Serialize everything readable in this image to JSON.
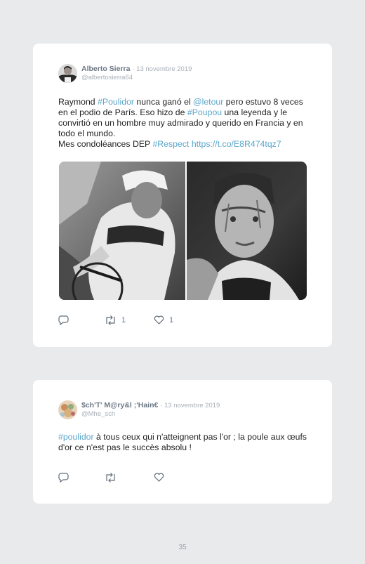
{
  "tweets": [
    {
      "name": "Alberto Sierra",
      "date": "· 13 novembre 2019",
      "handle": "@albertosierra64",
      "body": [
        [
          {
            "t": "Raymond "
          },
          {
            "t": "#Poulidor",
            "link": true
          },
          {
            "t": " nunca ganó el "
          },
          {
            "t": "@letour",
            "link": true
          },
          {
            "t": " pero estuvo 8 veces en el podio de París. Eso hizo de "
          },
          {
            "t": "#Poupou",
            "link": true
          },
          {
            "t": " una leyenda y le convirtió en un hombre muy admirado y querido en Francia y en todo el mundo."
          }
        ],
        [
          {
            "t": "Mes condoléances DEP "
          },
          {
            "t": "#Respect",
            "link": true
          },
          {
            "t": " "
          },
          {
            "t": "https://t.co/E8R474tqz7",
            "link": true
          }
        ]
      ],
      "retweets": "1",
      "likes": "1"
    },
    {
      "name": "$ch'T' M@ry&l ;'Hain€",
      "date": "· 13 novembre 2019",
      "handle": "@Mhe_sch",
      "body": [
        [
          {
            "t": "#poulidor",
            "link": true
          },
          {
            "t": " à tous ceux qui n'atteignent pas l'or ; la poule aux œufs d'or ce n'est pas le succès absolu !"
          }
        ]
      ],
      "retweets": "",
      "likes": ""
    }
  ],
  "icons": {
    "reply": "reply-icon",
    "retweet": "retweet-icon",
    "like": "heart-icon"
  },
  "colors": {
    "link": "#5ba6c9",
    "name": "#6b7785",
    "meta": "#a8b0b8"
  },
  "page_number": "35"
}
